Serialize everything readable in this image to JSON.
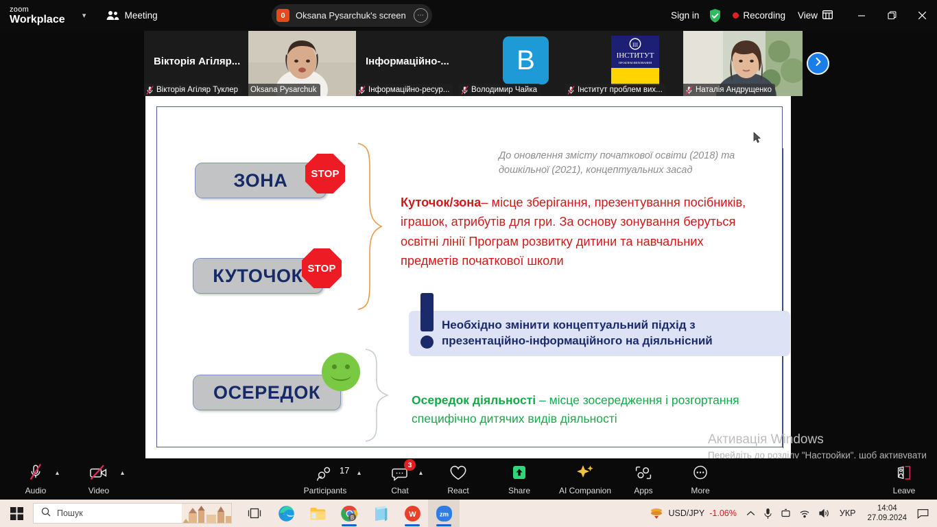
{
  "titlebar": {
    "logo_top": "zoom",
    "logo_bottom": "Workplace",
    "dropdown_icon": "chevron-down-icon",
    "meeting_label": "Meeting",
    "share_badge": "0",
    "share_label": "Oksana Pysarchuk's screen",
    "share_more_icon": "more-options-icon",
    "signin_label": "Sign in",
    "shield_icon": "security-shield-icon",
    "recording_label": "Recording",
    "view_label": "View",
    "view_icon": "layout-grid-icon",
    "minimize_icon": "minimize-icon",
    "maximize_icon": "restore-icon",
    "close_icon": "close-icon"
  },
  "thumbnails": [
    {
      "big_name": "Вікторія Агіляр...",
      "name": "Вікторія Агіляр Туклер",
      "muted": true,
      "active": false,
      "kind": "name-only"
    },
    {
      "big_name": "",
      "name": "Oksana Pysarchuk",
      "muted": false,
      "active": true,
      "kind": "video"
    },
    {
      "big_name": "Інформаційно-...",
      "name": "Інформаційно-ресур...",
      "muted": true,
      "active": false,
      "kind": "name-only"
    },
    {
      "big_name": "",
      "name": "Володимир Чайка",
      "muted": true,
      "active": false,
      "kind": "avatar",
      "avatar_letter": "В"
    },
    {
      "big_name": "",
      "name": "Інститут проблем вих...",
      "muted": true,
      "active": false,
      "kind": "logo",
      "logo_title": "ІНСТИТУТ",
      "logo_sub": "ПРОБЛЕМ ВИХОВАННЯ"
    },
    {
      "big_name": "",
      "name": "Наталія Андрущенко",
      "muted": true,
      "active": false,
      "kind": "video2"
    }
  ],
  "strip": {
    "next_icon": "chevron-right-icon"
  },
  "slide": {
    "boxes": [
      {
        "label": "ЗОНА",
        "marker": "stop-sign-icon"
      },
      {
        "label": "КУТОЧОК",
        "marker": "stop-sign-icon"
      },
      {
        "label": "ОСЕРЕДОК",
        "marker": "smiley-face-icon"
      }
    ],
    "stop_text": "STOP",
    "header_note": "До оновлення змісту початкової освіти (2018) та дошкільної (2021), концептуальних засад",
    "red_lead": "Куточок/зона",
    "red_body": "– місце зберігання, презентування посібників, іграшок, атрибутів для гри. За основу зонування беруться освітні лінії Програм розвитку дитини та навчальних предметів початкової школи",
    "callout_line1": "Необхідно змінити концептуальний підхід з",
    "callout_line2": "презентаційно-інформаційного на діяльнісний",
    "callout_icon": "exclamation-mark-icon",
    "green_lead": "Осередок діяльності",
    "green_body": " – місце зосередження і розгортання специфічно дитячих видів діяльності"
  },
  "watermark": {
    "line1": "Активація Windows",
    "line2": "Перейдіть до розділу \"Настройки\", щоб активувати Windows."
  },
  "toolbar": [
    {
      "label": "Audio",
      "icon": "microphone-muted-icon",
      "caret": true,
      "badge": ""
    },
    {
      "label": "Video",
      "icon": "camera-muted-icon",
      "caret": true,
      "badge": ""
    },
    {
      "label": "Participants",
      "icon": "participants-icon",
      "caret": true,
      "badge": "",
      "count": "17"
    },
    {
      "label": "Chat",
      "icon": "chat-bubble-icon",
      "caret": true,
      "badge": "3"
    },
    {
      "label": "React",
      "icon": "heart-icon",
      "caret": false,
      "badge": ""
    },
    {
      "label": "Share",
      "icon": "share-screen-icon",
      "caret": false,
      "badge": ""
    },
    {
      "label": "AI Companion",
      "icon": "ai-sparkle-icon",
      "caret": false,
      "badge": ""
    },
    {
      "label": "Apps",
      "icon": "apps-icon",
      "caret": false,
      "badge": ""
    },
    {
      "label": "More",
      "icon": "more-dots-icon",
      "caret": false,
      "badge": ""
    },
    {
      "label": "Leave",
      "icon": "leave-meeting-icon",
      "caret": false,
      "badge": ""
    }
  ],
  "taskbar": {
    "start_icon": "windows-start-icon",
    "search_placeholder": "Пошук",
    "search_icon": "search-icon",
    "apps": [
      {
        "name": "task-view-icon"
      },
      {
        "name": "edge-icon"
      },
      {
        "name": "file-explorer-icon"
      },
      {
        "name": "chrome-icon"
      },
      {
        "name": "notepad-icon"
      },
      {
        "name": "wps-office-icon"
      },
      {
        "name": "zoom-taskbar-icon"
      }
    ],
    "stock_symbol": "USD/JPY",
    "stock_change": "-1.06%",
    "tray_icons": [
      "show-hidden-icons",
      "microphone-icon",
      "screen-share-icon",
      "wifi-icon",
      "volume-icon"
    ],
    "language": "УКР",
    "time": "14:04",
    "date": "27.09.2024",
    "notification_icon": "notification-icon"
  },
  "colors": {
    "accent_blue": "#1b7ee8",
    "active_green": "#2fe07f",
    "red": "#d01a1a",
    "green": "#17a84a",
    "navy": "#1b2a6b",
    "taskbar_bg": "#f3e9e2"
  }
}
